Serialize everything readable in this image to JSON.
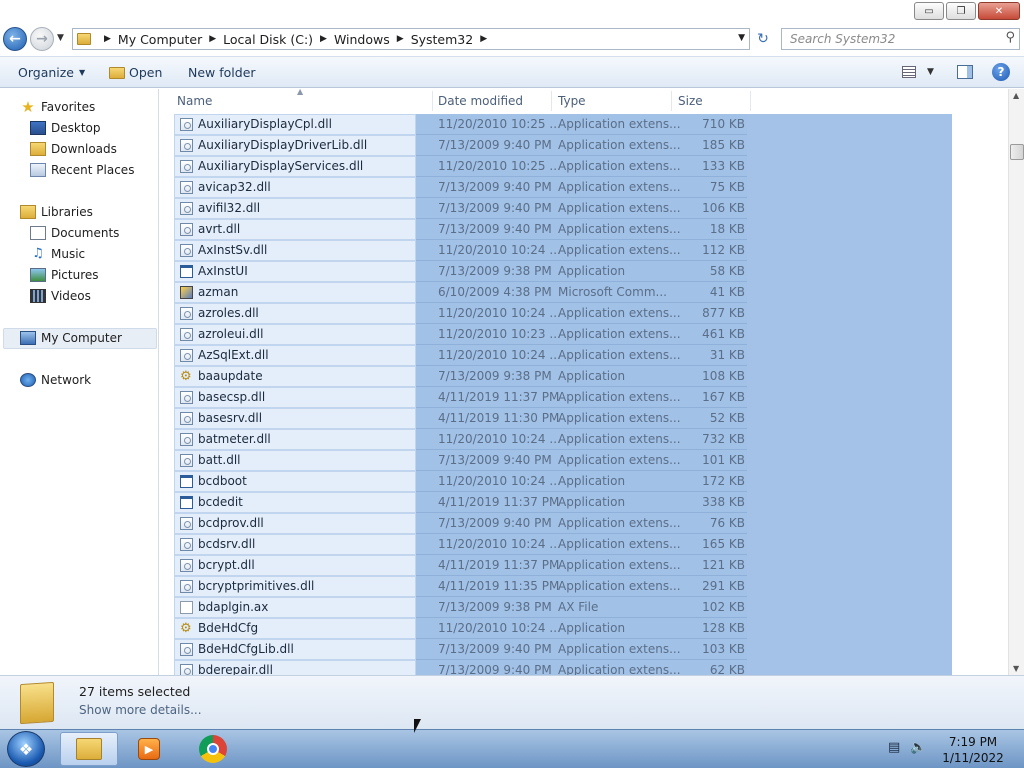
{
  "window": {
    "controls": {
      "minimize": "▭",
      "restore": "❐",
      "close": "✕"
    }
  },
  "address": {
    "breadcrumbs": [
      "My Computer",
      "Local Disk (C:)",
      "Windows",
      "System32"
    ],
    "search_placeholder": "Search System32"
  },
  "toolbar": {
    "organize_label": "Organize",
    "open_label": "Open",
    "new_folder_label": "New folder"
  },
  "nav": {
    "favorites": "Favorites",
    "desktop": "Desktop",
    "downloads": "Downloads",
    "recent_places": "Recent Places",
    "libraries": "Libraries",
    "documents": "Documents",
    "music": "Music",
    "pictures": "Pictures",
    "videos": "Videos",
    "my_computer": "My Computer",
    "network": "Network"
  },
  "columns": {
    "name": "Name",
    "date_modified": "Date modified",
    "type": "Type",
    "size": "Size"
  },
  "files": [
    {
      "name": "AuxiliaryDisplayCpl.dll",
      "date": "11/20/2010 10:25 ...",
      "type": "Application extens...",
      "size": "710 KB",
      "icon": "dll"
    },
    {
      "name": "AuxiliaryDisplayDriverLib.dll",
      "date": "7/13/2009 9:40 PM",
      "type": "Application extens...",
      "size": "185 KB",
      "icon": "dll"
    },
    {
      "name": "AuxiliaryDisplayServices.dll",
      "date": "11/20/2010 10:25 ...",
      "type": "Application extens...",
      "size": "133 KB",
      "icon": "dll"
    },
    {
      "name": "avicap32.dll",
      "date": "7/13/2009 9:40 PM",
      "type": "Application extens...",
      "size": "75 KB",
      "icon": "dll"
    },
    {
      "name": "avifil32.dll",
      "date": "7/13/2009 9:40 PM",
      "type": "Application extens...",
      "size": "106 KB",
      "icon": "dll"
    },
    {
      "name": "avrt.dll",
      "date": "7/13/2009 9:40 PM",
      "type": "Application extens...",
      "size": "18 KB",
      "icon": "dll"
    },
    {
      "name": "AxInstSv.dll",
      "date": "11/20/2010 10:24 ...",
      "type": "Application extens...",
      "size": "112 KB",
      "icon": "dll"
    },
    {
      "name": "AxInstUI",
      "date": "7/13/2009 9:38 PM",
      "type": "Application",
      "size": "58 KB",
      "icon": "app"
    },
    {
      "name": "azman",
      "date": "6/10/2009 4:38 PM",
      "type": "Microsoft Comm...",
      "size": "41 KB",
      "icon": "msc"
    },
    {
      "name": "azroles.dll",
      "date": "11/20/2010 10:24 ...",
      "type": "Application extens...",
      "size": "877 KB",
      "icon": "dll"
    },
    {
      "name": "azroleui.dll",
      "date": "11/20/2010 10:23 ...",
      "type": "Application extens...",
      "size": "461 KB",
      "icon": "dll"
    },
    {
      "name": "AzSqlExt.dll",
      "date": "11/20/2010 10:24 ...",
      "type": "Application extens...",
      "size": "31 KB",
      "icon": "dll"
    },
    {
      "name": "baaupdate",
      "date": "7/13/2009 9:38 PM",
      "type": "Application",
      "size": "108 KB",
      "icon": "gear"
    },
    {
      "name": "basecsp.dll",
      "date": "4/11/2019 11:37 PM",
      "type": "Application extens...",
      "size": "167 KB",
      "icon": "dll"
    },
    {
      "name": "basesrv.dll",
      "date": "4/11/2019 11:30 PM",
      "type": "Application extens...",
      "size": "52 KB",
      "icon": "dll"
    },
    {
      "name": "batmeter.dll",
      "date": "11/20/2010 10:24 ...",
      "type": "Application extens...",
      "size": "732 KB",
      "icon": "dll"
    },
    {
      "name": "batt.dll",
      "date": "7/13/2009 9:40 PM",
      "type": "Application extens...",
      "size": "101 KB",
      "icon": "dll"
    },
    {
      "name": "bcdboot",
      "date": "11/20/2010 10:24 ...",
      "type": "Application",
      "size": "172 KB",
      "icon": "app"
    },
    {
      "name": "bcdedit",
      "date": "4/11/2019 11:37 PM",
      "type": "Application",
      "size": "338 KB",
      "icon": "app"
    },
    {
      "name": "bcdprov.dll",
      "date": "7/13/2009 9:40 PM",
      "type": "Application extens...",
      "size": "76 KB",
      "icon": "dll"
    },
    {
      "name": "bcdsrv.dll",
      "date": "11/20/2010 10:24 ...",
      "type": "Application extens...",
      "size": "165 KB",
      "icon": "dll"
    },
    {
      "name": "bcrypt.dll",
      "date": "4/11/2019 11:37 PM",
      "type": "Application extens...",
      "size": "121 KB",
      "icon": "dll"
    },
    {
      "name": "bcryptprimitives.dll",
      "date": "4/11/2019 11:35 PM",
      "type": "Application extens...",
      "size": "291 KB",
      "icon": "dll"
    },
    {
      "name": "bdaplgin.ax",
      "date": "7/13/2009 9:38 PM",
      "type": "AX File",
      "size": "102 KB",
      "icon": "file"
    },
    {
      "name": "BdeHdCfg",
      "date": "11/20/2010 10:24 ...",
      "type": "Application",
      "size": "128 KB",
      "icon": "gear"
    },
    {
      "name": "BdeHdCfgLib.dll",
      "date": "7/13/2009 9:40 PM",
      "type": "Application extens...",
      "size": "103 KB",
      "icon": "dll"
    },
    {
      "name": "bderepair.dll",
      "date": "7/13/2009 9:40 PM",
      "type": "Application extens...",
      "size": "62 KB",
      "icon": "dll"
    }
  ],
  "details": {
    "selection_count": "27 items selected",
    "show_more": "Show more details..."
  },
  "taskbar": {
    "time": "7:19 PM",
    "date": "1/11/2022"
  },
  "colors": {
    "selection": "#a4c2e8",
    "toolbar_bg": "#dfe9f5",
    "taskbar_bg": "#6d95c4"
  }
}
